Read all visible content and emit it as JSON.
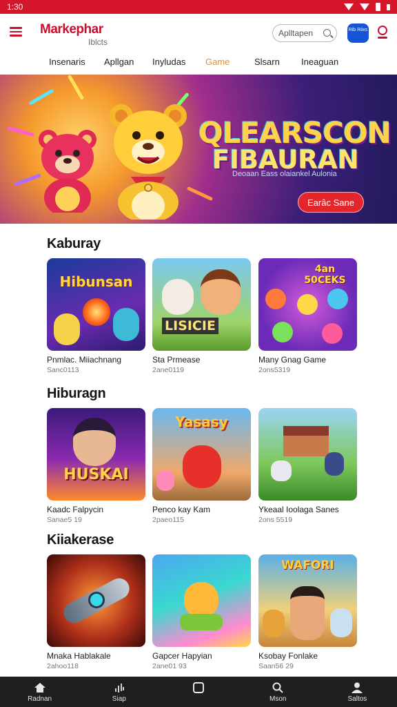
{
  "status": {
    "time": "1:30"
  },
  "header": {
    "brand_name": "Markephar",
    "brand_sub": "Iblcts",
    "search_placeholder": "Aplltapen",
    "app_badge": "Rib Riixs"
  },
  "tabs": [
    {
      "label": "Insenaris"
    },
    {
      "label": "Apllgan"
    },
    {
      "label": "Inyludas"
    },
    {
      "label": "Game",
      "active": true
    },
    {
      "label": "Slsarn"
    },
    {
      "label": "Ineaguan"
    }
  ],
  "banner": {
    "title_line1": "QLEARSCON",
    "title_line2": "FIBAURAN",
    "subtitle": "Deoaan Eass olaiankel Aulonia",
    "button": "Earâc Sane"
  },
  "sections": [
    {
      "title": "Kaburay",
      "cards": [
        {
          "thumb_text": "Hibunsan",
          "title": "Pnmlac. Miiachnang",
          "meta": "Sanc0113"
        },
        {
          "thumb_text": "LISICIE",
          "title": "Sta Prmease",
          "meta": "2ane0119"
        },
        {
          "thumb_text": "4an 50CEKS",
          "title": "Many Gnag Game",
          "meta": "2ons5319"
        }
      ]
    },
    {
      "title": "Hiburagn",
      "cards": [
        {
          "thumb_text": "HUSKAI",
          "title": "Kaadc Falpycin",
          "meta": "Sanae5 19"
        },
        {
          "thumb_text": "Yasasy",
          "title": "Penco kay Kam",
          "meta": "2paeo115"
        },
        {
          "thumb_text": "",
          "title": "Ykeaal Ioolaga Sanes",
          "meta": "2ons 5519"
        }
      ]
    },
    {
      "title": "Kiiakerase",
      "cards": [
        {
          "thumb_text": "",
          "title": "Mnaka Hablakale",
          "meta": "2ahoo118"
        },
        {
          "thumb_text": "",
          "title": "Gapcer Hapyian",
          "meta": "2ane01 93"
        },
        {
          "thumb_text": "WAFORI",
          "title": "Ksobay Fonlake",
          "meta": "Saan56 29"
        }
      ]
    }
  ],
  "bottom_nav": [
    {
      "label": "Radnan",
      "icon": "home-icon"
    },
    {
      "label": "Siap",
      "icon": "sound-icon"
    },
    {
      "label": "",
      "icon": "square-icon"
    },
    {
      "label": "Mson",
      "icon": "search-icon"
    },
    {
      "label": "Saltos",
      "icon": "profile-icon"
    }
  ],
  "colors": {
    "brand": "#c8102e",
    "accent_tab": "#e0912a",
    "banner_button": "#e3262c"
  }
}
